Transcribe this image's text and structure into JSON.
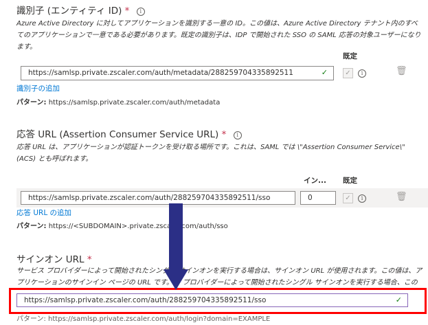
{
  "identifier": {
    "title": "識別子 (エンティティ ID)",
    "required": "*",
    "info_icon": "info-icon",
    "description": "Azure Active Directory に対してアプリケーションを識別する一意の ID。この値は、Azure Active Directory テナント内のすべてのアプリケーションで一意である必要があります。既定の識別子は、IDP で開始された SSO の SAML 応答の対象ユーザーになります。",
    "col_default": "既定",
    "value": "https://samlsp.private.zscaler.com/auth/metadata/288259704335892511",
    "add_link": "識別子の追加",
    "pattern_label": "パターン:",
    "pattern_value": "https://samlsp.private.zscaler.com/auth/metadata"
  },
  "reply_url": {
    "title": "応答 URL (Assertion Consumer Service URL)",
    "required": "*",
    "description": "応答 URL は、アプリケーションが認証トークンを受け取る場所です。これは、SAML では \\\"Assertion Consumer Service\\\" (ACS) とも呼ばれます。",
    "col_index": "イン...",
    "col_default": "既定",
    "value": "https://samlsp.private.zscaler.com/auth/288259704335892511/sso",
    "index_value": "0",
    "add_link": "応答 URL の追加",
    "pattern_label": "パターン:",
    "pattern_value": "https://<SUBDOMAIN>.private.zscaler.com/auth/sso"
  },
  "signon_url": {
    "title": "サインオン URL",
    "required": "*",
    "description": "サービス プロバイダーによって開始されたシングル サインオンを実行する場合は、サインオン URL が使用されます。この値は、アプリケーションのサインイン ページの URL です。ID プロバイダーによって開始されたシングル サインオンを実行する場合、このフィールドは不要です。",
    "value": "https://samlsp.private.zscaler.com/auth/288259704335892511/sso",
    "pattern_partial": "パターン: https://samlsp.private.zscaler.com/auth/login?domain=EXAMPLE"
  },
  "colors": {
    "accent": "#0078d4",
    "required": "#c4314b",
    "valid": "#107c10",
    "highlight": "#ff0000",
    "arrow": "#2b2f86"
  }
}
